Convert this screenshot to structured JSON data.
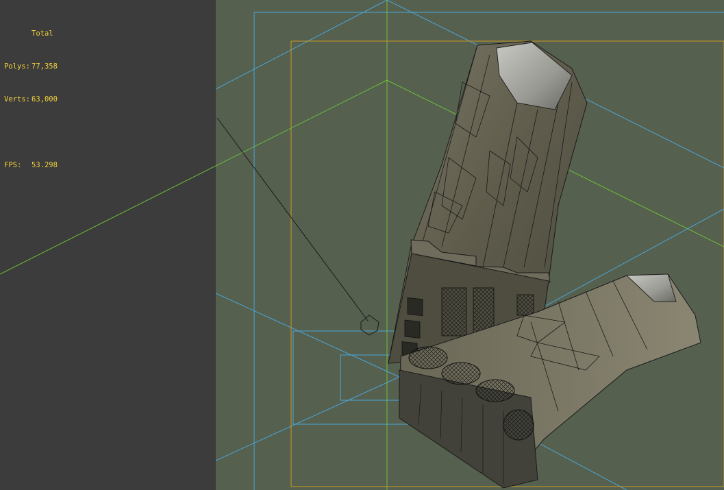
{
  "stats": {
    "header": "Total",
    "polys_label": "Polys:",
    "polys_value": "77,358",
    "verts_label": "Verts:",
    "verts_value": "63,000",
    "fps_label": "FPS:",
    "fps_value": "53.298"
  },
  "colors": {
    "stats_text": "#f2d23c",
    "viewport_bg": "#56604f",
    "left_bg": "#3c3c3c",
    "grid_green": "#6fbf3a",
    "frustum_blue": "#4aa6d8",
    "safe_frame": "#c99a22",
    "wire": "#1a1a1a"
  }
}
